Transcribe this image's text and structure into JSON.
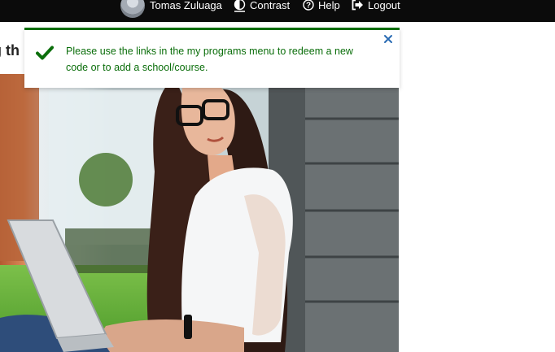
{
  "header": {
    "user_name": "Tomas Zuluaga",
    "contrast_label": "Contrast",
    "help_label": "Help",
    "logout_label": "Logout"
  },
  "page": {
    "heading_fragment": "g th"
  },
  "alert": {
    "message": "Please use the links in the my programs menu to redeem a new code or to add a school/course.",
    "status_color": "#0b6e0b",
    "icon": "check-icon",
    "close_icon": "close-icon"
  },
  "hero": {
    "image": "photo-woman-with-glasses-and-laptop"
  }
}
